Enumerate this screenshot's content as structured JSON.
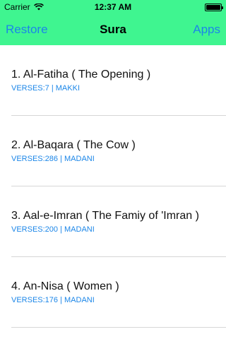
{
  "status_bar": {
    "carrier": "Carrier",
    "time": "12:37 AM",
    "wifi_icon": "wifi-icon",
    "battery_icon": "battery-icon",
    "battery_level": 1.0
  },
  "nav": {
    "left_label": "Restore",
    "title": "Sura",
    "right_label": "Apps"
  },
  "colors": {
    "nav_background": "#3ff590",
    "accent": "#1b86e8"
  },
  "suras": [
    {
      "title": "1. Al-Fatiha ( The Opening )",
      "meta": "VERSES:7 | MAKKI"
    },
    {
      "title": "2. Al-Baqara ( The Cow )",
      "meta": "VERSES:286 | MADANI"
    },
    {
      "title": "3. Aal-e-Imran ( The Famiy of 'Imran )",
      "meta": "VERSES:200 | MADANI"
    },
    {
      "title": "4. An-Nisa ( Women )",
      "meta": "VERSES:176 | MADANI"
    }
  ]
}
